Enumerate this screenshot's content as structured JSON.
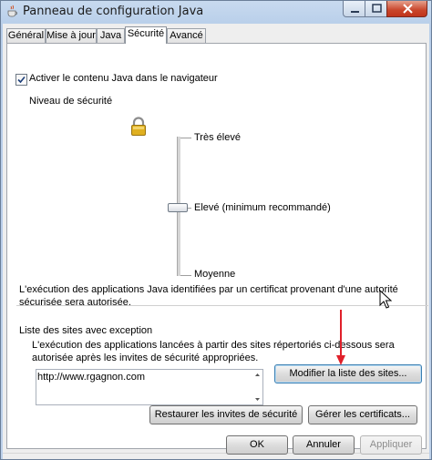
{
  "window": {
    "title": "Panneau de configuration Java"
  },
  "tabs": [
    {
      "label": "Général"
    },
    {
      "label": "Mise à jour"
    },
    {
      "label": "Java"
    },
    {
      "label": "Sécurité"
    },
    {
      "label": "Avancé"
    }
  ],
  "active_tab": "Sécurité",
  "security": {
    "enable_checkbox_label": "Activer le contenu Java dans le navigateur",
    "enable_checked": true,
    "level_label": "Niveau de sécurité",
    "levels": {
      "very_high": "Très élevé",
      "high": "Elevé (minimum recommandé)",
      "medium": "Moyenne"
    },
    "selected_level": "Elevé (minimum recommandé)",
    "description": "L'exécution des applications Java identifiées par un certificat provenant d'une autorité sécurisée sera autorisée."
  },
  "exceptions": {
    "group_label": "Liste des sites avec exception",
    "description": "L'exécution des applications lancées à partir des sites répertoriés ci-dessous sera autorisée après les invites de sécurité appropriées.",
    "sites": [
      "http://www.rgagnon.com"
    ],
    "edit_button": "Modifier la liste des sites..."
  },
  "actions": {
    "restore_prompts": "Restaurer les invites de sécurité",
    "manage_certs": "Gérer les certificats..."
  },
  "dialog_buttons": {
    "ok": "OK",
    "cancel": "Annuler",
    "apply": "Appliquer"
  },
  "colors": {
    "annotation_arrow": "#e0202a",
    "title_bar": "#bcd0ea",
    "close_button": "#c9452a"
  }
}
